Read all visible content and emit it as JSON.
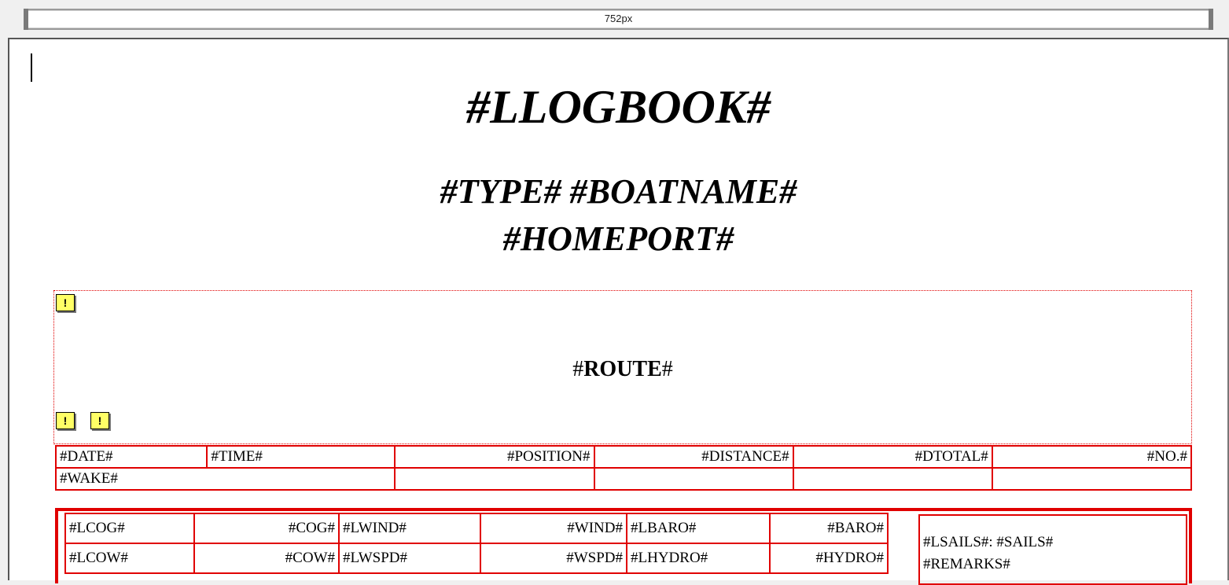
{
  "ruler": {
    "label": "752px"
  },
  "document": {
    "title": "#LLOGBOOK#",
    "subtitle_line1": "#TYPE# #BOATNAME#",
    "subtitle_line2": "#HOMEPORT#",
    "route": {
      "prefix": "#",
      "bold": "ROUTE",
      "suffix": "#"
    },
    "warning_glyph": "!"
  },
  "header_table": {
    "date": "#DATE#",
    "time": "#TIME#",
    "wake": "#WAKE#",
    "position": "#POSITION#",
    "distance": "#DISTANCE#",
    "dtotal": "#DTOTAL#",
    "no": "#NO.#"
  },
  "detail_table": {
    "row1": [
      "#LCOG#",
      "#COG#",
      "#LWIND#",
      "#WIND#",
      "#LBARO#",
      "#BARO#"
    ],
    "row2": [
      "#LCOW#",
      "#COW#",
      "#LWSPD#",
      "#WSPD#",
      "#LHYDRO#",
      "#HYDRO#"
    ]
  },
  "remarks": {
    "sails": "#LSAILS#: #SAILS#",
    "remarks": "#REMARKS#"
  },
  "colors": {
    "table_border": "#e00000",
    "warning_bg": "#ffff66"
  }
}
